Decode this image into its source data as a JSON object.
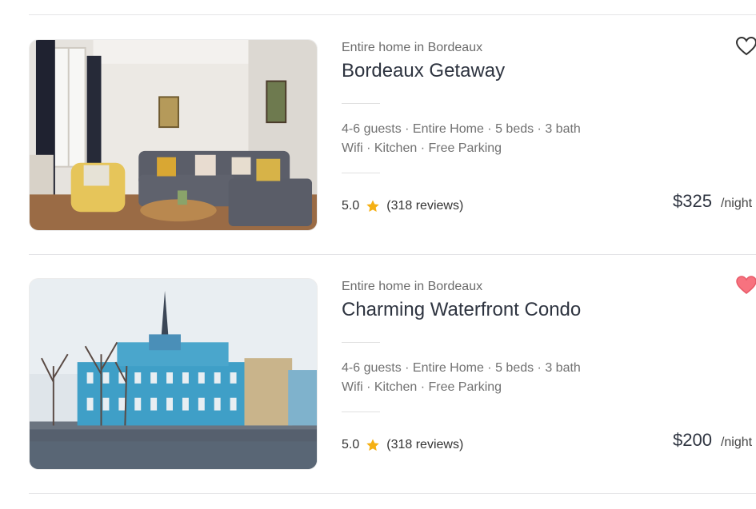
{
  "listings": [
    {
      "subtitle": "Entire home in Bordeaux",
      "title": "Bordeaux Getaway",
      "details": "4-6 guests · Entire Home · 5 beds · 3 bath",
      "amenities": "Wifi · Kitchen · Free Parking",
      "rating": "5.0",
      "reviews": "(318 reviews)",
      "price": "$325",
      "price_unit": "/night",
      "favorited": false
    },
    {
      "subtitle": "Entire home in Bordeaux",
      "title": "Charming Waterfront Condo",
      "details": "4-6 guests · Entire Home · 5 beds · 3 bath",
      "amenities": "Wifi · Kitchen · Free Parking",
      "rating": "5.0",
      "reviews": "(318 reviews)",
      "price": "$200",
      "price_unit": "/night",
      "favorited": true
    }
  ],
  "colors": {
    "star": "#f5b014",
    "heart_active": "#f7727f",
    "heart_outline": "#333333"
  },
  "icons": {
    "favorite": "heart-icon",
    "rating": "star-icon"
  }
}
